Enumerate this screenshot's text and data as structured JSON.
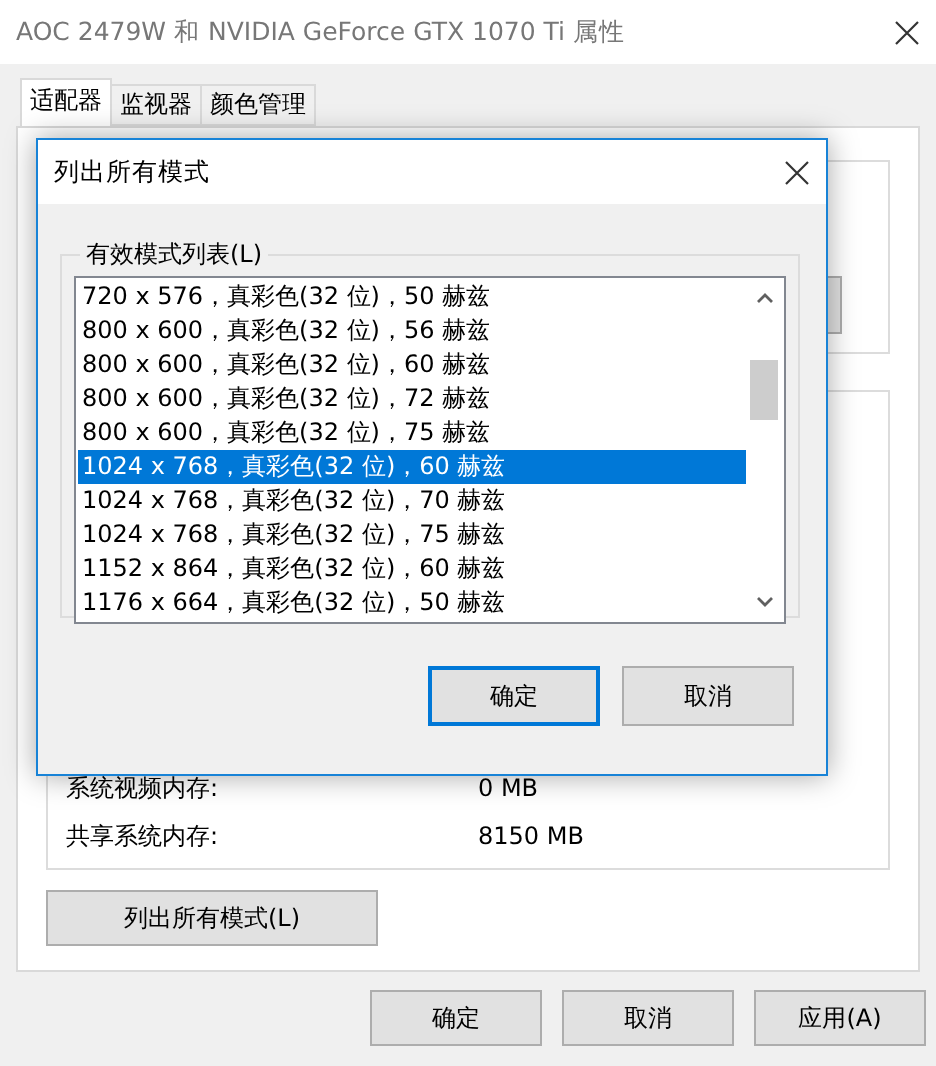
{
  "window": {
    "title": "AOC 2479W 和 NVIDIA GeForce GTX 1070 Ti 属性"
  },
  "tabs": [
    {
      "label": "适配器",
      "selected": true
    },
    {
      "label": "监视器",
      "selected": false
    },
    {
      "label": "颜色管理",
      "selected": false
    }
  ],
  "panel": {
    "memory_rows": [
      {
        "label": "系统视频内存:",
        "value": "0 MB"
      },
      {
        "label": "共享系统内存:",
        "value": "8150 MB"
      }
    ],
    "list_modes_button": "列出所有模式(L)"
  },
  "buttons": [
    "确定",
    "取消",
    "应用(A)"
  ],
  "dialog": {
    "title": "列出所有模式",
    "group_label": "有效模式列表(L)",
    "modes": [
      {
        "label": "720 x 576，真彩色(32 位)，50 赫兹",
        "selected": false
      },
      {
        "label": "800 x 600，真彩色(32 位)，56 赫兹",
        "selected": false
      },
      {
        "label": "800 x 600，真彩色(32 位)，60 赫兹",
        "selected": false
      },
      {
        "label": "800 x 600，真彩色(32 位)，72 赫兹",
        "selected": false
      },
      {
        "label": "800 x 600，真彩色(32 位)，75 赫兹",
        "selected": false
      },
      {
        "label": "1024 x 768，真彩色(32 位)，60 赫兹",
        "selected": true
      },
      {
        "label": "1024 x 768，真彩色(32 位)，70 赫兹",
        "selected": false
      },
      {
        "label": "1024 x 768，真彩色(32 位)，75 赫兹",
        "selected": false
      },
      {
        "label": "1152 x 864，真彩色(32 位)，60 赫兹",
        "selected": false
      },
      {
        "label": "1176 x 664，真彩色(32 位)，50 赫兹",
        "selected": false
      }
    ],
    "buttons": [
      {
        "label": "确定",
        "default": true
      },
      {
        "label": "取消",
        "default": false
      }
    ]
  }
}
